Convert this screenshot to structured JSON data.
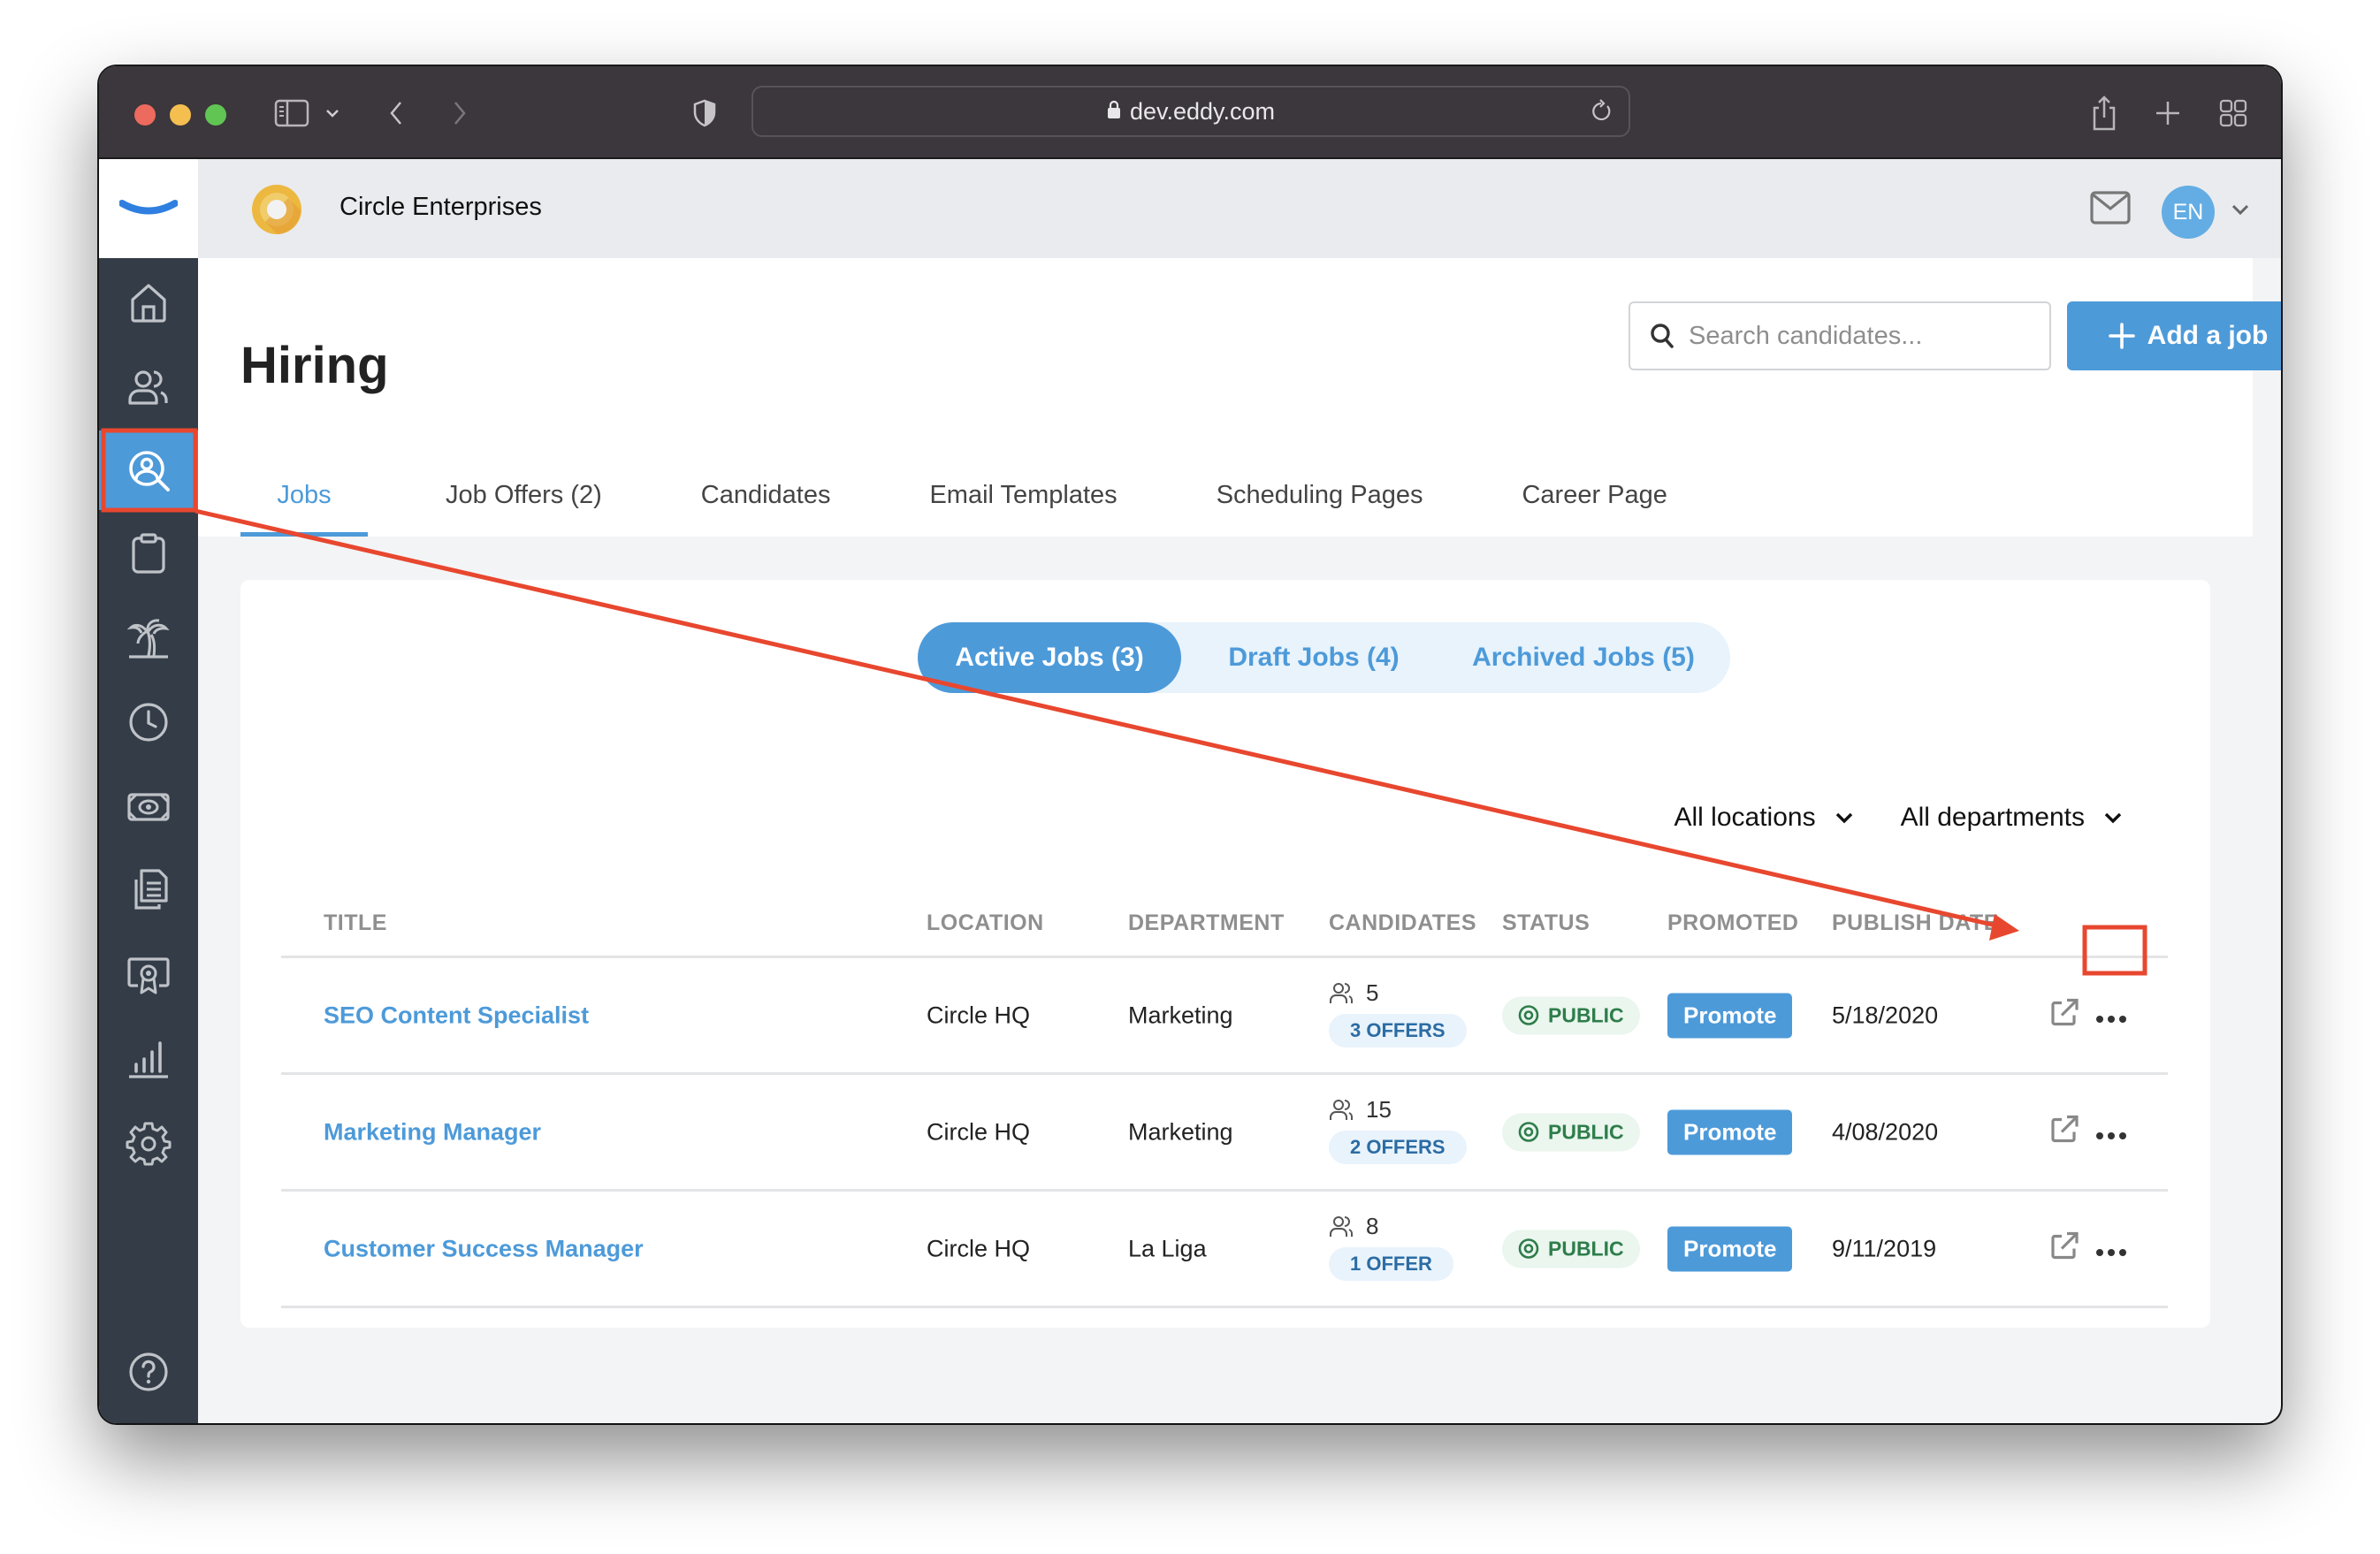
{
  "browser": {
    "url": "dev.eddy.com"
  },
  "topbar": {
    "company_name": "Circle Enterprises",
    "avatar_initials": "EN"
  },
  "sidebar": {
    "items": [
      {
        "icon": "home-icon"
      },
      {
        "icon": "people-icon"
      },
      {
        "icon": "hiring-search-person-icon",
        "active": true
      },
      {
        "icon": "clipboard-icon"
      },
      {
        "icon": "palm-tree-icon"
      },
      {
        "icon": "clock-icon"
      },
      {
        "icon": "money-icon"
      },
      {
        "icon": "documents-icon"
      },
      {
        "icon": "certificate-icon"
      },
      {
        "icon": "bar-chart-icon"
      },
      {
        "icon": "gear-icon"
      }
    ],
    "help_icon": "help-icon"
  },
  "page": {
    "title": "Hiring",
    "search_placeholder": "Search candidates...",
    "add_job_label": "Add a job",
    "tabs": [
      {
        "label": "Jobs",
        "active": true
      },
      {
        "label": "Job Offers (2)"
      },
      {
        "label": "Candidates"
      },
      {
        "label": "Email Templates"
      },
      {
        "label": "Scheduling Pages"
      },
      {
        "label": "Career Page"
      }
    ]
  },
  "jobs": {
    "segments": [
      {
        "label": "Active Jobs (3)",
        "active": true
      },
      {
        "label": "Draft Jobs (4)"
      },
      {
        "label": "Archived Jobs (5)"
      }
    ],
    "filters": {
      "location": "All locations",
      "department": "All departments"
    },
    "columns": [
      "TITLE",
      "LOCATION",
      "DEPARTMENT",
      "CANDIDATES",
      "STATUS",
      "PROMOTED",
      "PUBLISH DATE"
    ],
    "rows": [
      {
        "title": "SEO Content Specialist",
        "location": "Circle HQ",
        "department": "Marketing",
        "candidates": "5",
        "offers": "3 OFFERS",
        "status": "PUBLIC",
        "promote": "Promote",
        "publish_date": "5/18/2020"
      },
      {
        "title": "Marketing Manager",
        "location": "Circle HQ",
        "department": "Marketing",
        "candidates": "15",
        "offers": "2 OFFERS",
        "status": "PUBLIC",
        "promote": "Promote",
        "publish_date": "4/08/2020"
      },
      {
        "title": "Customer Success Manager",
        "location": "Circle HQ",
        "department": "La Liga",
        "candidates": "8",
        "offers": "1 OFFER",
        "status": "PUBLIC",
        "promote": "Promote",
        "publish_date": "9/11/2019"
      }
    ]
  },
  "colors": {
    "accent": "#4d9ad9",
    "sidebar": "#333c47",
    "annotation": "#e8472f",
    "status_green": "#2e7d4a"
  }
}
